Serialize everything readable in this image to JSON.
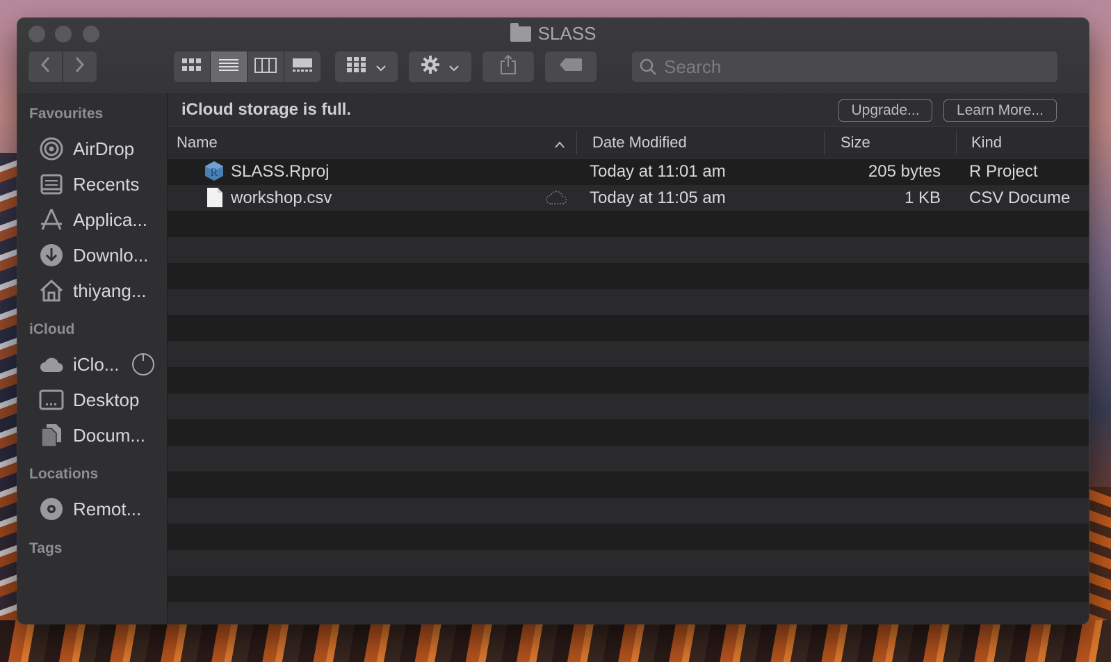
{
  "window": {
    "title": "SLASS"
  },
  "toolbar": {
    "back": "‹",
    "forward": "›",
    "view_modes": [
      "icon-view",
      "list-view",
      "column-view",
      "gallery-view"
    ],
    "selected_view": "list-view",
    "search_placeholder": "Search"
  },
  "banner": {
    "text": "iCloud storage is full.",
    "upgrade": "Upgrade...",
    "learn_more": "Learn More..."
  },
  "sidebar": {
    "favourites_heading": "Favourites",
    "favourites": [
      {
        "label": "AirDrop",
        "icon": "airdrop-icon"
      },
      {
        "label": "Recents",
        "icon": "recents-icon"
      },
      {
        "label": "Applica...",
        "icon": "applications-icon"
      },
      {
        "label": "Downlo...",
        "icon": "downloads-icon"
      },
      {
        "label": "thiyang...",
        "icon": "home-icon"
      }
    ],
    "icloud_heading": "iCloud",
    "icloud": [
      {
        "label": "iClo...",
        "icon": "icloud-drive-icon"
      },
      {
        "label": "Desktop",
        "icon": "desktop-icon"
      },
      {
        "label": "Docum...",
        "icon": "documents-icon"
      }
    ],
    "locations_heading": "Locations",
    "locations": [
      {
        "label": "Remot...",
        "icon": "remote-disc-icon"
      }
    ],
    "tags_heading": "Tags"
  },
  "columns": {
    "name": "Name",
    "date": "Date Modified",
    "size": "Size",
    "kind": "Kind"
  },
  "files": [
    {
      "name": "SLASS.Rproj",
      "date": "Today at 11:01 am",
      "size": "205 bytes",
      "kind": "R Project",
      "icon": "r-project-icon"
    },
    {
      "name": "workshop.csv",
      "date": "Today at 11:05 am",
      "size": "1 KB",
      "kind": "CSV Docume",
      "icon": "document-icon"
    }
  ],
  "colors": {
    "window_bg": "#2a2a2c",
    "sidebar_bg": "#2f2f31",
    "row_alt": "#2a2a2c",
    "text": "#d8d8da"
  }
}
